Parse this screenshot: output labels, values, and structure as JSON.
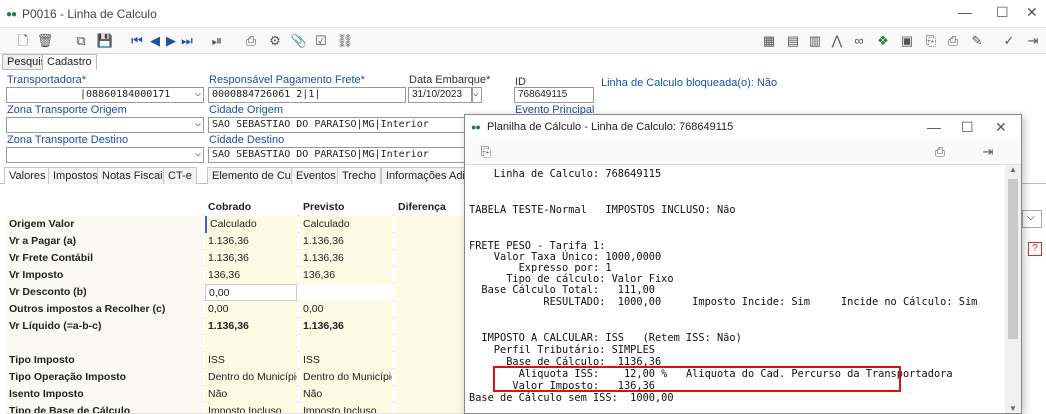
{
  "window": {
    "title": "P0016 - Linha de Calculo"
  },
  "tabs_top": [
    "Pesquisa",
    "Cadastro"
  ],
  "form": {
    "transportadora_label": "Transportadora*",
    "transportadora_value": "|08860184000171",
    "responsavel_label": "Responsável Pagamento Frete*",
    "responsavel_value": "0000884726061 2|1|",
    "data_embarque_label": "Data Embarque*",
    "data_embarque_value": "31/10/2023",
    "id_label": "ID",
    "id_value": "768649115",
    "bloqueada_text": "Linha de Calculo bloqueada(o): Não",
    "zona_origem_label": "Zona Transporte Origem",
    "cidade_origem_label": "Cidade Origem",
    "cidade_origem_value": "SAO SEBASTIAO DO PARAISO|MG|Interior",
    "evento_principal_label": "Evento Principal",
    "zona_destino_label": "Zona Transporte Destino",
    "cidade_destino_label": "Cidade Destino",
    "cidade_destino_value": "SAO SEBASTIAO DO PARAISO|MG|Interior"
  },
  "tabs_main": [
    "Valores",
    "Impostos",
    "Notas Fiscais",
    "CT-e",
    "Elemento de Custo",
    "Eventos",
    "Trecho",
    "Informações Adiciona"
  ],
  "grid": {
    "headers": [
      "",
      "Cobrado",
      "Previsto",
      "Diferença"
    ],
    "rows": [
      [
        "Origem Valor",
        "Calculado",
        "Calculado",
        ""
      ],
      [
        "Vr a Pagar (a)",
        "1.136,36",
        "1.136,36",
        ""
      ],
      [
        "Vr Frete Contábil",
        "1.136,36",
        "1.136,36",
        ""
      ],
      [
        "Vr Imposto",
        "136,36",
        "136,36",
        ""
      ],
      [
        "Vr Desconto (b)",
        "0,00",
        "",
        ""
      ],
      [
        "Outros impostos a Recolher (c)",
        "0,00",
        "0,00",
        ""
      ],
      [
        "Vr Líquido (=a-b-c)",
        "1.136,36",
        "1.136,36",
        ""
      ],
      [
        "",
        "",
        "",
        ""
      ],
      [
        "Tipo Imposto",
        "ISS",
        "ISS",
        ""
      ],
      [
        "Tipo Operação Imposto",
        "Dentro do Município",
        "Dentro do Município",
        ""
      ],
      [
        "Isento Imposto",
        "Não",
        "Não",
        ""
      ],
      [
        "Tipo de Base de Cálculo",
        "Imposto Incluso",
        "Imposto Incluso",
        ""
      ]
    ]
  },
  "modal": {
    "title": "Planilha de Cálculo - Linha de Calculo: 768649115",
    "lines": [
      "    Linha de Calculo: 768649115",
      "",
      "",
      "TABELA TESTE-Normal   IMPOSTOS INCLUSO: Não",
      "",
      "",
      "FRETE PESO - Tarifa 1:",
      "    Valor Taxa Único: 1000,0000",
      "        Expresso por: 1",
      "      Tipo de cálculo: Valor Fixo",
      "  Base Cálculo Total:   111,00",
      "            RESULTADO:  1000,00     Imposto Incide: Sim     Incide no Cálculo: Sim",
      "",
      "",
      "  IMPOSTO A CALCULAR: ISS   (Retem ISS: Não)",
      "    Perfil Tributário: SIMPLES",
      "      Base de Cálculo:  1136,36",
      "        Aliquota ISS:    12,00 %   Aliquota do Cad. Percurso da Transportadora",
      "       Valor Imposto:   136,36",
      "Base de Cálculo sem ISS:  1000,00"
    ]
  },
  "side_help": "?"
}
